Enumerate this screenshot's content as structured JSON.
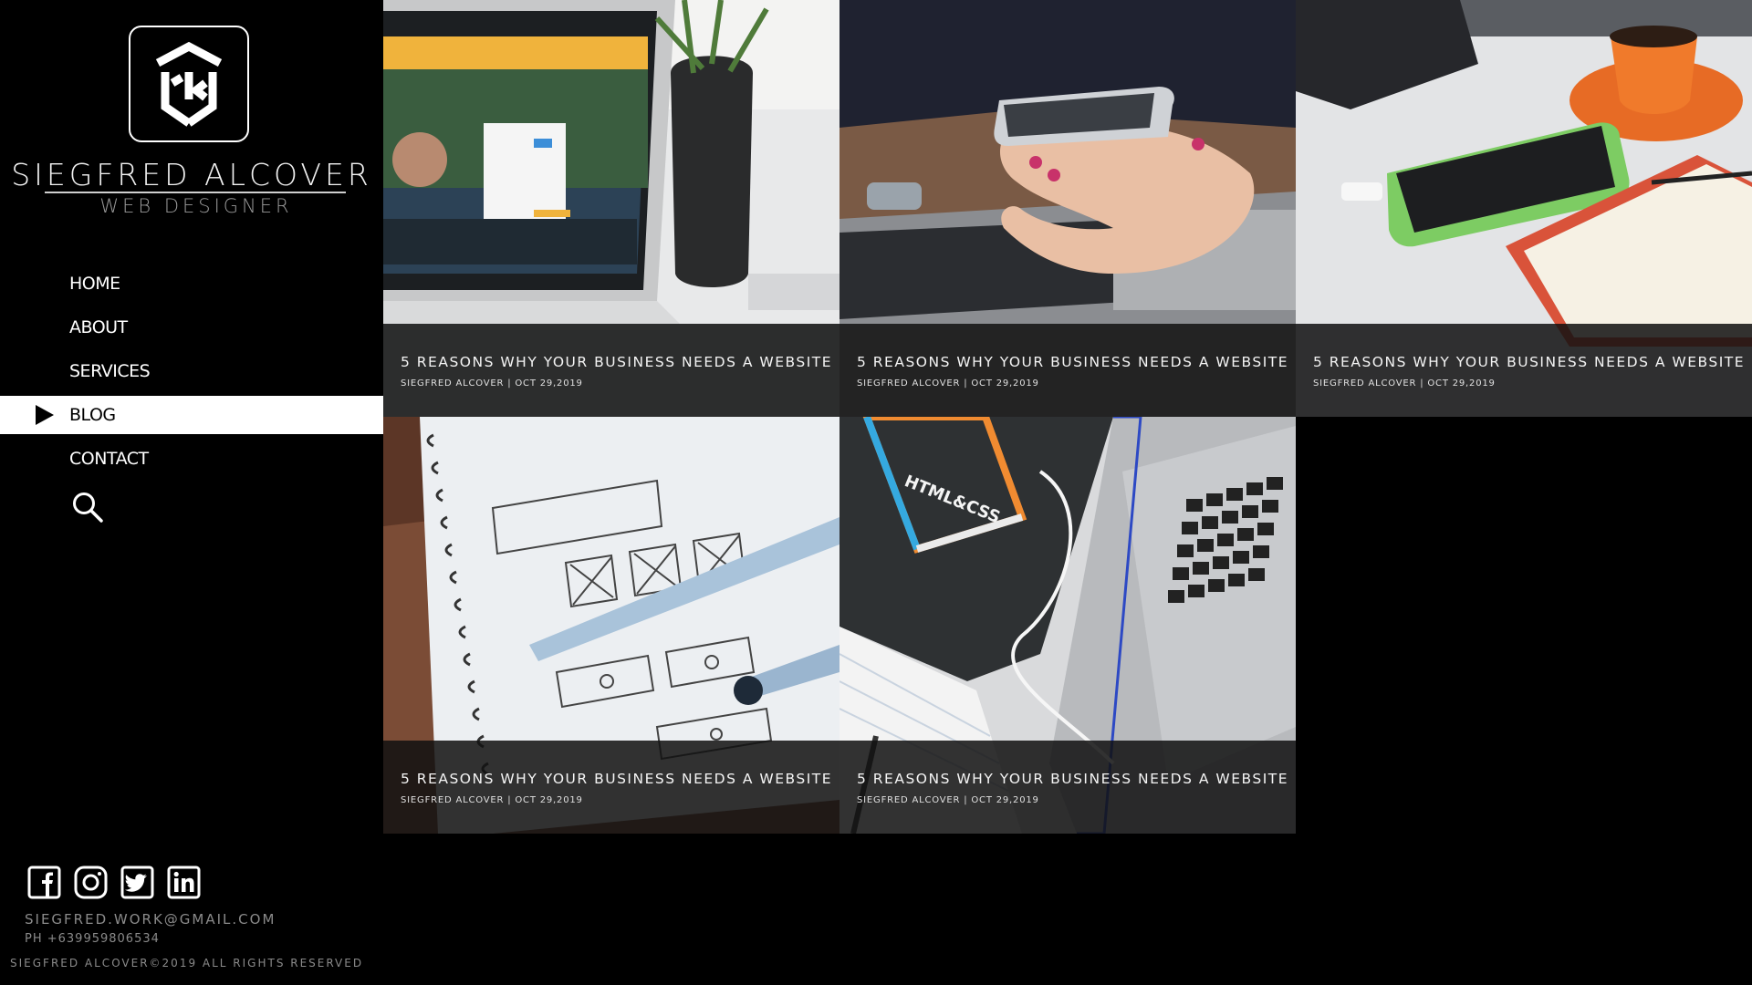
{
  "brand": {
    "name": "SIEGFRED ALCOVER",
    "role": "WEB DESIGNER"
  },
  "nav": {
    "items": [
      {
        "label": "HOME",
        "active": false
      },
      {
        "label": "ABOUT",
        "active": false
      },
      {
        "label": "SERVICES",
        "active": false
      },
      {
        "label": "BLOG",
        "active": true
      },
      {
        "label": "CONTACT",
        "active": false
      }
    ],
    "search_icon": "search-icon"
  },
  "social": {
    "icons": [
      "facebook-icon",
      "instagram-icon",
      "twitter-icon",
      "linkedin-icon"
    ]
  },
  "contact": {
    "email": "SIEGFRED.WORK@GMAIL.COM",
    "phone": "PH +639959806534"
  },
  "footer": {
    "copyright": "SIEGFRED ALCOVER©2019 ALL RIGHTS RESERVED"
  },
  "posts": [
    {
      "title": "5 REASONS WHY YOUR BUSINESS NEEDS A WEBSITE",
      "author": "SIEGFRED ALCOVER",
      "date": "OCT 29,2019",
      "meta": "SIEGFRED ALCOVER | OCT 29,2019",
      "image": "laptop-twitter-photo"
    },
    {
      "title": "5 REASONS WHY YOUR BUSINESS NEEDS A WEBSITE",
      "author": "SIEGFRED ALCOVER",
      "date": "OCT 29,2019",
      "meta": "SIEGFRED ALCOVER | OCT 29,2019",
      "image": "hand-phone-photo"
    },
    {
      "title": "5 REASONS WHY YOUR BUSINESS NEEDS A WEBSITE",
      "author": "SIEGFRED ALCOVER",
      "date": "OCT 29,2019",
      "meta": "SIEGFRED ALCOVER | OCT 29,2019",
      "image": "desk-phone-coffee-photo"
    },
    {
      "title": "5 REASONS WHY YOUR BUSINESS NEEDS A WEBSITE",
      "author": "SIEGFRED ALCOVER",
      "date": "OCT 29,2019",
      "meta": "SIEGFRED ALCOVER | OCT 29,2019",
      "image": "wireframe-sketch-photo"
    },
    {
      "title": "5 REASONS WHY YOUR BUSINESS NEEDS A WEBSITE",
      "author": "SIEGFRED ALCOVER",
      "date": "OCT 29,2019",
      "meta": "SIEGFRED ALCOVER | OCT 29,2019",
      "image": "html-css-book-photo"
    }
  ],
  "colors": {
    "background": "#000000",
    "caption_bg": "#121212",
    "active_nav_bg": "#ffffff",
    "muted_text": "#8a8a8a"
  }
}
